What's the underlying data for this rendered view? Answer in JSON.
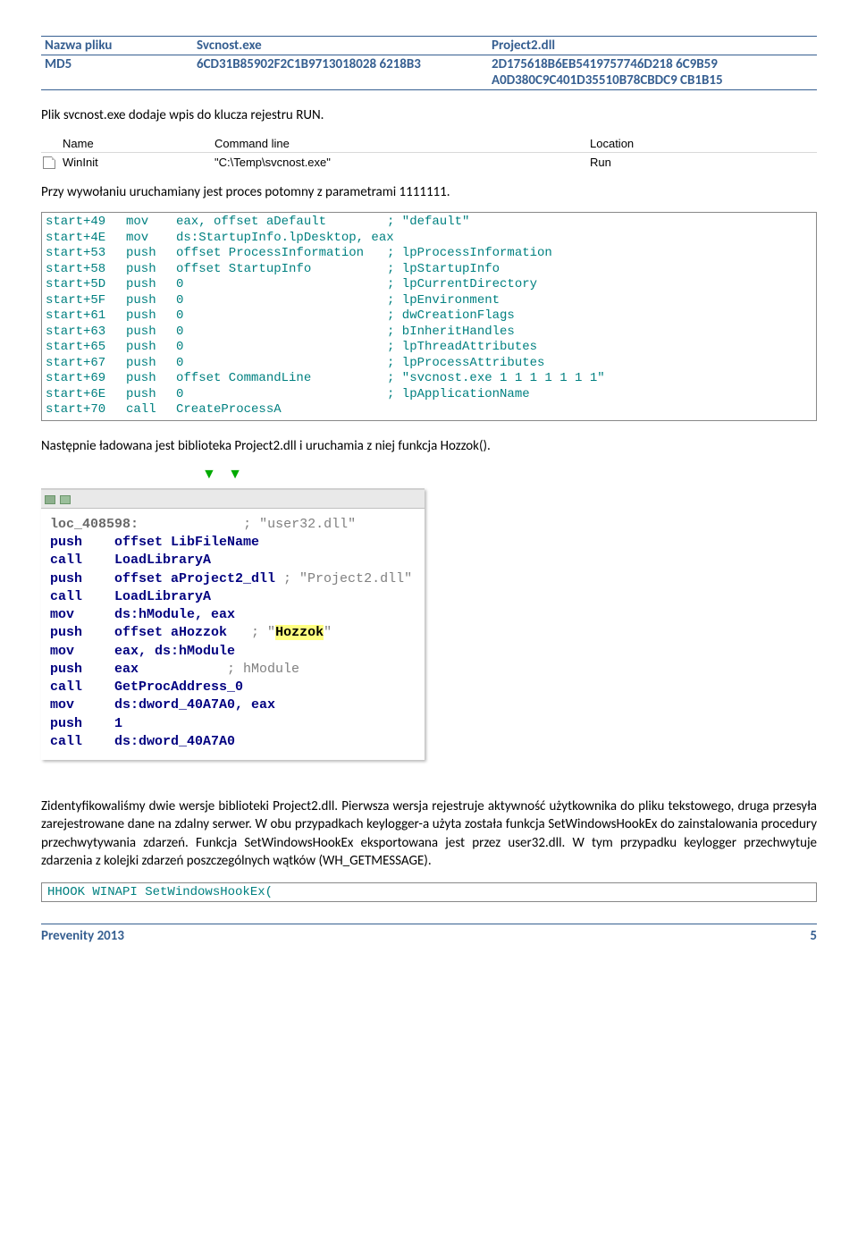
{
  "header": {
    "row1": {
      "label": "Nazwa pliku",
      "col2": "Svcnost.exe",
      "col3": "Project2.dll"
    },
    "row2": {
      "label": "MD5",
      "col2": "6CD31B85902F2C1B9713018028 6218B3",
      "col3a": "2D175618B6EB5419757746D218 6C9B59",
      "col3b": "A0D380C9C401D35510B78CBDC9 CB1B15"
    }
  },
  "p1": "Plik svcnost.exe dodaje wpis do klucza rejestru RUN.",
  "autoruns": {
    "h_name": "Name",
    "h_cmd": "Command line",
    "h_loc": "Location",
    "row_name": "WinInit",
    "row_cmd": "\"C:\\Temp\\svcnost.exe\"",
    "row_loc": "Run"
  },
  "p2": "Przy wywołaniu uruchamiany jest proces potomny z parametrami 1111111.",
  "asm": [
    {
      "addr": "start+49",
      "op": "mov",
      "arg": "eax, offset aDefault",
      "cmt": "; \"default\""
    },
    {
      "addr": "start+4E",
      "op": "mov",
      "arg": "ds:StartupInfo.lpDesktop, eax",
      "cmt": ""
    },
    {
      "addr": "start+53",
      "op": "push",
      "arg": "offset ProcessInformation",
      "cmt": "; lpProcessInformation"
    },
    {
      "addr": "start+58",
      "op": "push",
      "arg": "offset StartupInfo",
      "cmt": "; lpStartupInfo"
    },
    {
      "addr": "start+5D",
      "op": "push",
      "arg": "0",
      "cmt": "; lpCurrentDirectory"
    },
    {
      "addr": "start+5F",
      "op": "push",
      "arg": "0",
      "cmt": "; lpEnvironment"
    },
    {
      "addr": "start+61",
      "op": "push",
      "arg": "0",
      "cmt": "; dwCreationFlags"
    },
    {
      "addr": "start+63",
      "op": "push",
      "arg": "0",
      "cmt": "; bInheritHandles"
    },
    {
      "addr": "start+65",
      "op": "push",
      "arg": "0",
      "cmt": "; lpThreadAttributes"
    },
    {
      "addr": "start+67",
      "op": "push",
      "arg": "0",
      "cmt": "; lpProcessAttributes"
    },
    {
      "addr": "start+69",
      "op": "push",
      "arg": "offset CommandLine",
      "cmt": "; \"svcnost.exe 1 1 1 1 1 1 1\""
    },
    {
      "addr": "start+6E",
      "op": "push",
      "arg": "0",
      "cmt": "; lpApplicationName"
    },
    {
      "addr": "start+70",
      "op": "call",
      "arg": "CreateProcessA",
      "cmt": ""
    }
  ],
  "p3": "Następnie ładowana jest biblioteka Project2.dll i uruchamia z niej funkcja Hozzok().",
  "ida": {
    "loc_label": "loc_408598:",
    "loc_cmt": "; \"user32.dll\"",
    "lines": [
      [
        "push",
        "offset LibFileName",
        ""
      ],
      [
        "call",
        "LoadLibraryA",
        ""
      ],
      [
        "push",
        "offset aProject2_dll",
        " ; \"Project2.dll\""
      ],
      [
        "call",
        "LoadLibraryA",
        ""
      ],
      [
        "mov",
        "ds:hModule, eax",
        ""
      ],
      [
        "push",
        "offset aHozzok",
        "   ; \""
      ],
      [
        "mov",
        "eax, ds:hModule",
        ""
      ],
      [
        "push",
        "eax",
        "           ; hModule"
      ],
      [
        "call",
        "GetProcAddress_0",
        ""
      ],
      [
        "mov",
        "ds:dword_40A7A0, eax",
        ""
      ],
      [
        "push",
        "1",
        ""
      ],
      [
        "call",
        "ds:dword_40A7A0",
        ""
      ]
    ],
    "hozzok": "Hozzok",
    "quote_close": "\""
  },
  "p4": "Zidentyfikowaliśmy dwie wersje biblioteki Project2.dll. Pierwsza wersja rejestruje aktywność użytkownika do pliku tekstowego, druga przesyła zarejestrowane dane na zdalny serwer. W obu przypadkach keylogger-a użyta została funkcja SetWindowsHookEx do zainstalowania procedury przechwytywania zdarzeń. Funkcja SetWindowsHookEx eksportowana jest przez user32.dll. W tym przypadku keylogger przechwytuje zdarzenia z kolejki zdarzeń poszczególnych wątków (WH_GETMESSAGE).",
  "codesig": "HHOOK WINAPI SetWindowsHookEx(",
  "footer": {
    "left": "Prevenity 2013",
    "right": "5"
  }
}
